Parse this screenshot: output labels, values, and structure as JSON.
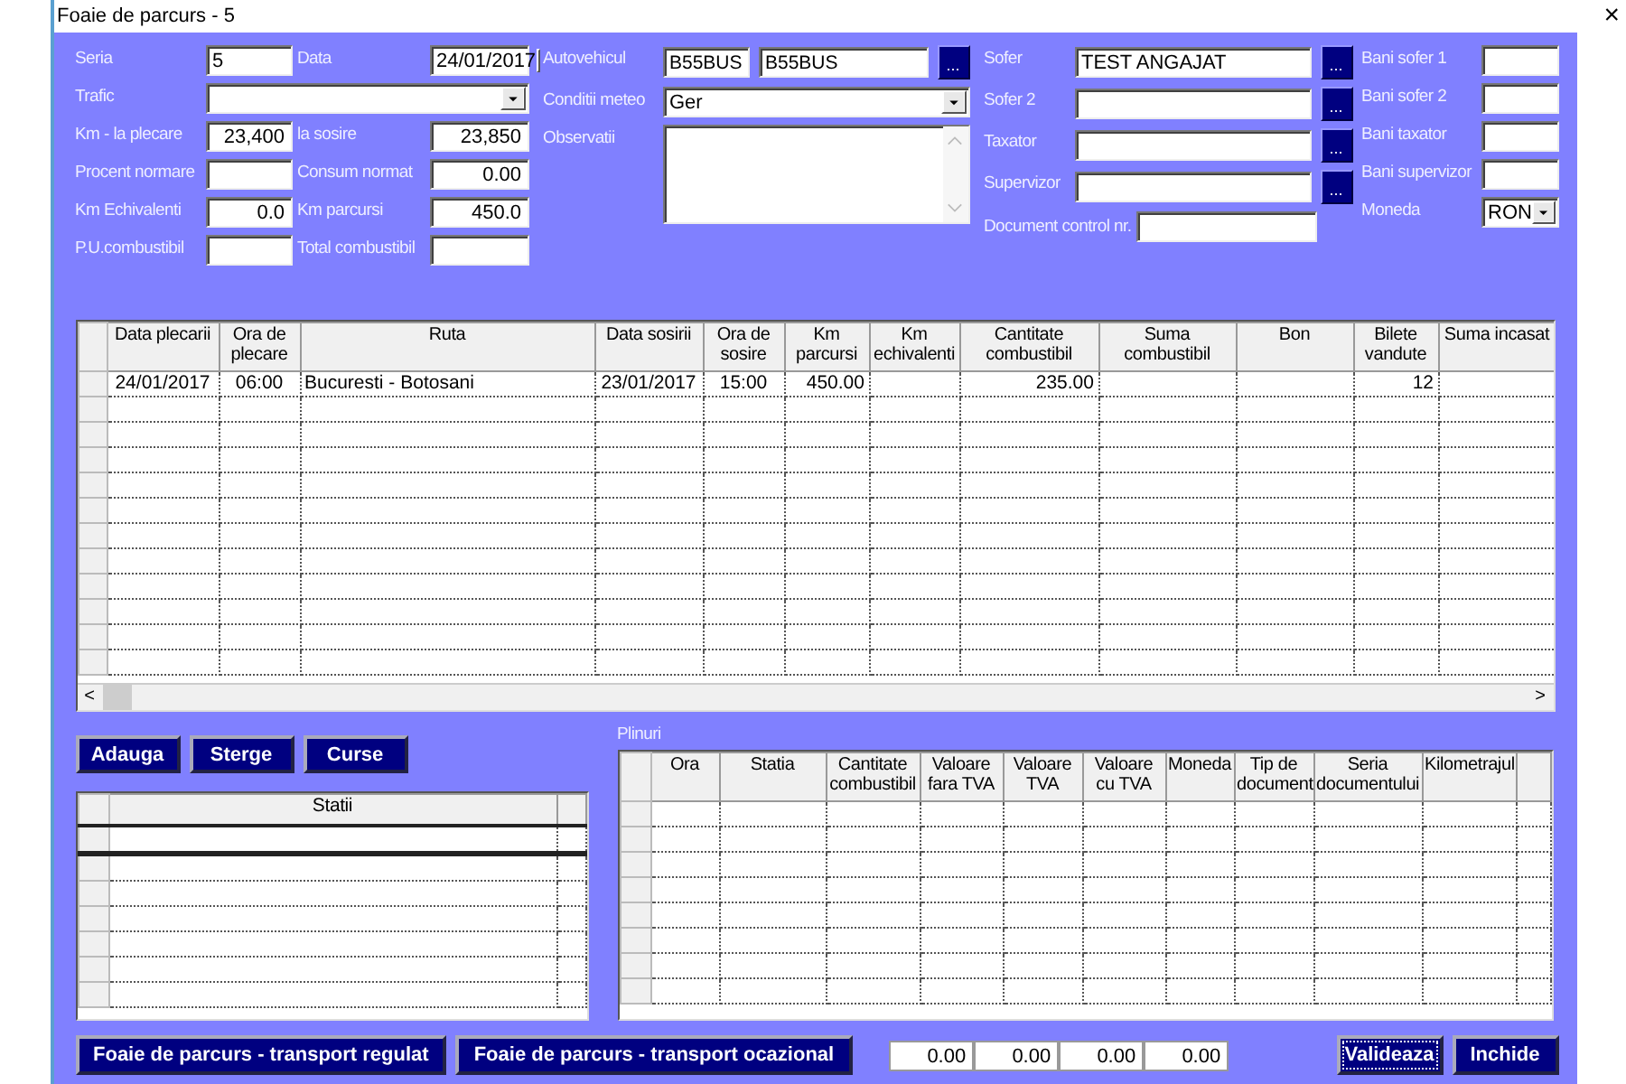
{
  "window": {
    "title": "Foaie de parcurs - 5",
    "close": "×"
  },
  "form": {
    "seria": {
      "label": "Seria",
      "value": "5"
    },
    "data": {
      "label": "Data",
      "value": "24/01/2017"
    },
    "trafic": {
      "label": "Trafic"
    },
    "km_plecare": {
      "label": "Km - la plecare",
      "value": "23,400"
    },
    "la_sosire": {
      "label": "la sosire",
      "value": "23,850"
    },
    "procent_normare": {
      "label": "Procent normare"
    },
    "consum_normat": {
      "label": "Consum normat",
      "value": "0.00"
    },
    "km_echivalenti": {
      "label": "Km Echivalenti",
      "value": "0.0"
    },
    "km_parcursi": {
      "label": "Km parcursi",
      "value": "450.0"
    },
    "pu_combustibil": {
      "label": "P.U.combustibil"
    },
    "total_combustibil": {
      "label": "Total combustibil"
    },
    "autovehicul": {
      "label": "Autovehicul",
      "code": "B55BUS",
      "name": "B55BUS",
      "button": "..."
    },
    "conditii_meteo": {
      "label": "Conditii meteo",
      "value": "Ger"
    },
    "observatii": {
      "label": "Observatii"
    },
    "persons": [
      {
        "label": "Sofer",
        "value": "TEST ANGAJAT",
        "button": "..."
      },
      {
        "label": "Sofer 2",
        "button": "..."
      },
      {
        "label": "Taxator",
        "button": "..."
      },
      {
        "label": "Supervizor",
        "button": "..."
      }
    ],
    "document_control": {
      "label": "Document control nr."
    },
    "bani": [
      {
        "label": "Bani sofer 1"
      },
      {
        "label": "Bani sofer 2"
      },
      {
        "label": "Bani taxator"
      },
      {
        "label": "Bani supervizor"
      }
    ],
    "moneda": {
      "label": "Moneda",
      "value": "RON"
    }
  },
  "trips_table": {
    "columns": [
      "Data plecarii",
      "Ora de plecare",
      "Ruta",
      "Data sosirii",
      "Ora de sosire",
      "Km parcursi",
      "Km echivalenti",
      "Cantitate combustibil",
      "Suma combustibil",
      "Bon",
      "Bilete vandute",
      "Suma incasat"
    ],
    "rows": [
      [
        "24/01/2017",
        "06:00",
        "Bucuresti - Botosani",
        "23/01/2017",
        "15:00",
        "450.00",
        null,
        "235.00",
        null,
        null,
        "12",
        null
      ]
    ],
    "scroll_left": "<",
    "scroll_right": ">"
  },
  "station_buttons": [
    "Adauga",
    "Sterge",
    "Curse"
  ],
  "stations_table": {
    "columns": [
      "Statii"
    ]
  },
  "plinuri": {
    "title": "Plinuri",
    "columns": [
      "Ora",
      "Statia",
      "Cantitate combustibil",
      "Valoare fara TVA",
      "Valoare TVA",
      "Valoare cu TVA",
      "Moneda",
      "Tip de document",
      "Seria documentului",
      "Kilometrajul"
    ]
  },
  "footer": {
    "buttons": [
      "Foaie de parcurs - transport regulat",
      "Foaie de parcurs - transport ocazional"
    ],
    "totals": [
      "0.00",
      "0.00",
      "0.00",
      "0.00"
    ],
    "actions": [
      {
        "label": "Valideaza",
        "focused": true
      },
      {
        "label": "Inchide",
        "focused": false
      }
    ]
  }
}
